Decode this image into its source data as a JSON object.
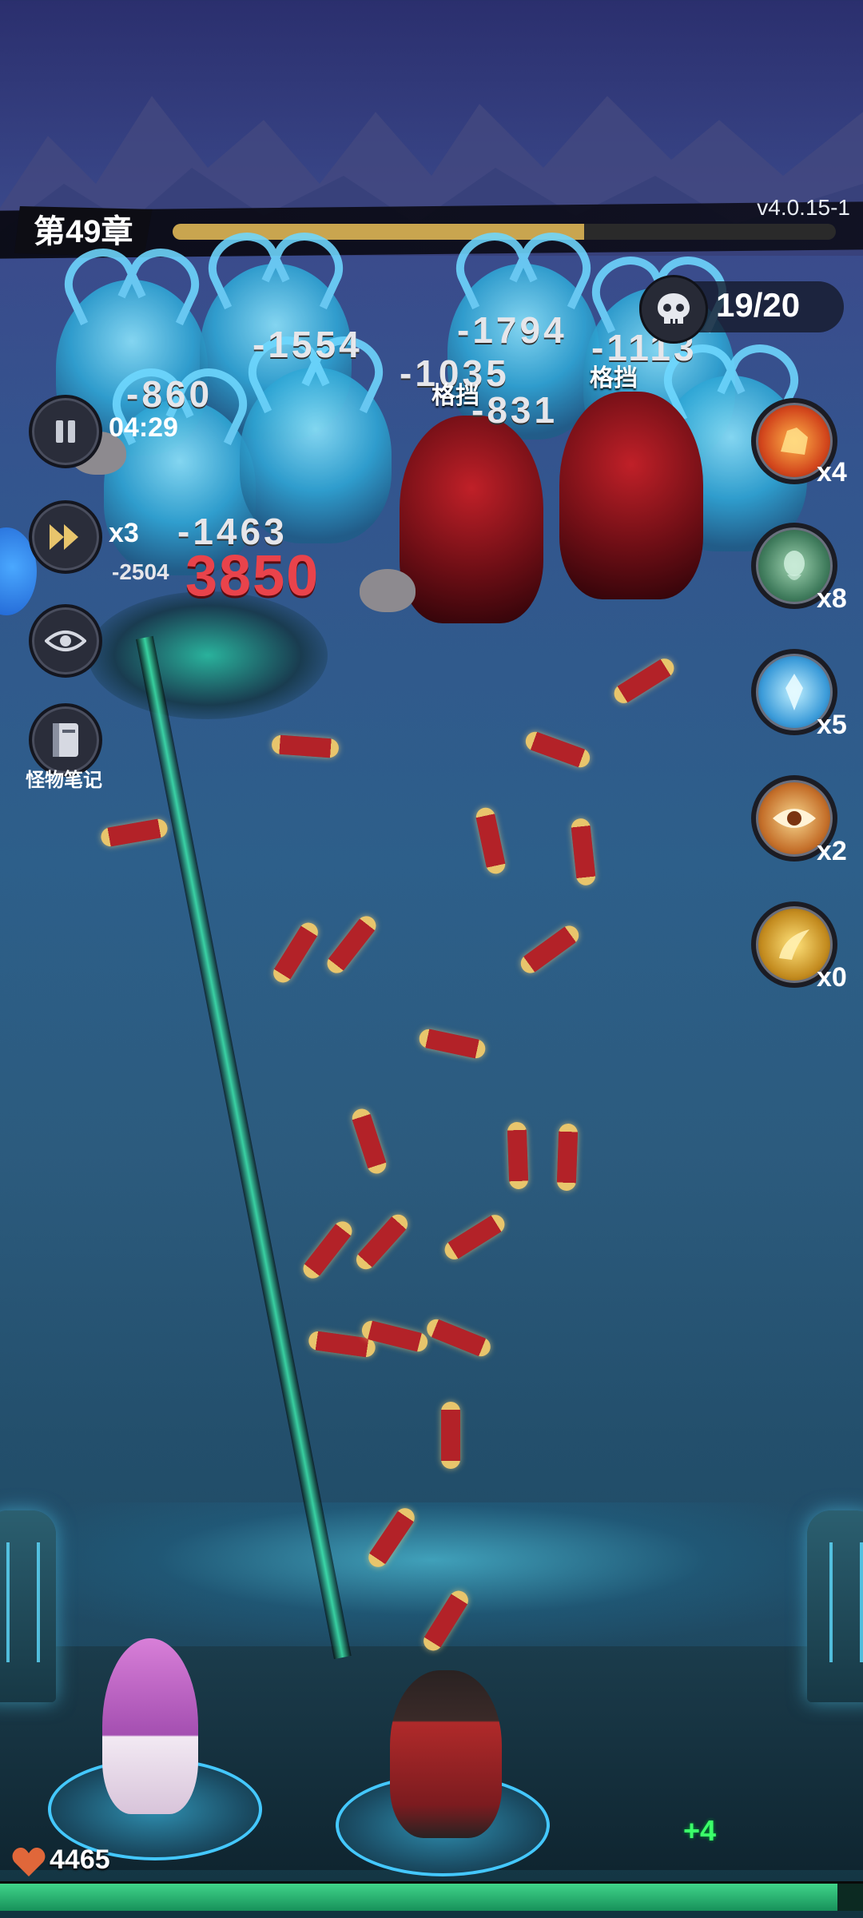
{
  "header": {
    "chapter_label": "第49章",
    "version": "v4.0.15-1",
    "chapter_progress": 0.62
  },
  "controls": {
    "timer": "04:29",
    "speed_label": "x3",
    "notes_label": "怪物笔记"
  },
  "kills": {
    "text": "19/20",
    "icon": "skull-icon"
  },
  "skills": [
    {
      "icon": "fire-fist-icon",
      "count": "x4"
    },
    {
      "icon": "green-spirit-icon",
      "count": "x8"
    },
    {
      "icon": "ice-crystal-icon",
      "count": "x5"
    },
    {
      "icon": "eye-icon",
      "count": "x2"
    },
    {
      "icon": "golden-horn-icon",
      "count": "x0"
    }
  ],
  "damage_numbers": [
    "-1554",
    "-860",
    "-1794",
    "-1035",
    "-1463",
    "-2504",
    "-831",
    "-1113"
  ],
  "crit_number": "3850",
  "block_labels": [
    "格挡",
    "格挡"
  ],
  "player": {
    "hp": "4465",
    "heal_popup": "+4",
    "hp_fraction": 0.97
  },
  "colors": {
    "progress": "#c9a54f",
    "hp_bar": "#2bb673",
    "crit": "#e9434b"
  }
}
